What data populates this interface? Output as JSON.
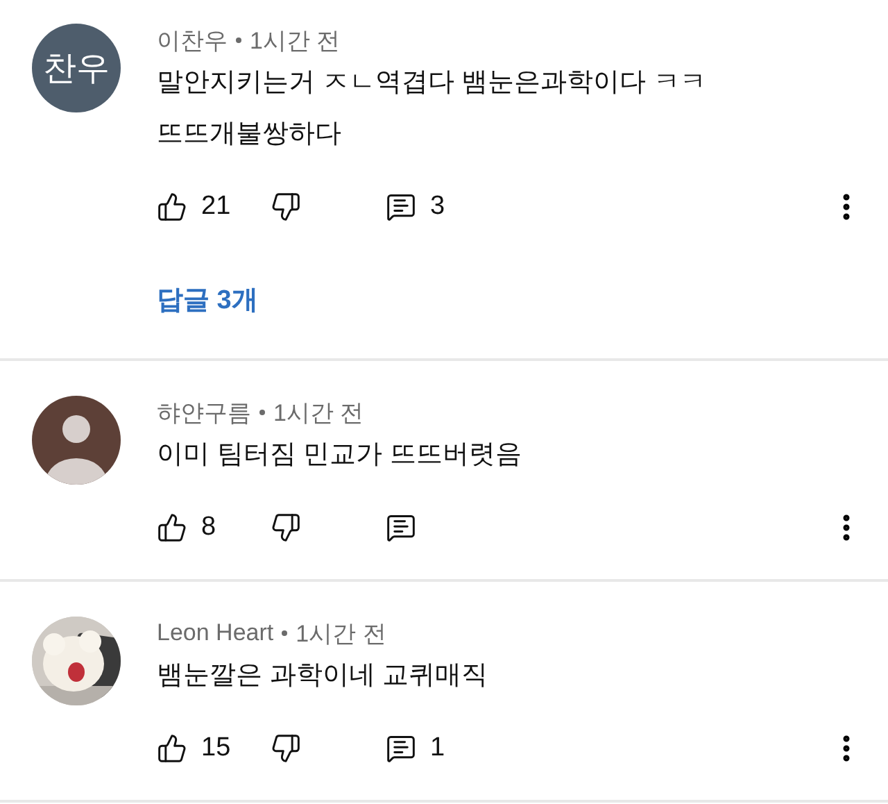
{
  "comments": [
    {
      "avatar": {
        "kind": "initials",
        "text": "찬우"
      },
      "author": "이찬우",
      "time": "1시간 전",
      "lines": [
        "말안지키는거 ㅈㄴ역겹다 뱀눈은과학이다 ㅋㅋ",
        "뜨뜨개불쌍하다"
      ],
      "likes": "21",
      "reply_count": "3",
      "replies_link": "답글 3개"
    },
    {
      "avatar": {
        "kind": "default"
      },
      "author": "햐얀구름",
      "time": "1시간 전",
      "lines": [
        "이미 팀터짐 민교가 뜨뜨버렷음"
      ],
      "likes": "8"
    },
    {
      "avatar": {
        "kind": "picture"
      },
      "author": "Leon Heart",
      "time": "1시간 전",
      "lines": [
        "뱀눈깔은 과학이네 교퀴매직"
      ],
      "likes": "15",
      "reply_count": "1"
    }
  ]
}
